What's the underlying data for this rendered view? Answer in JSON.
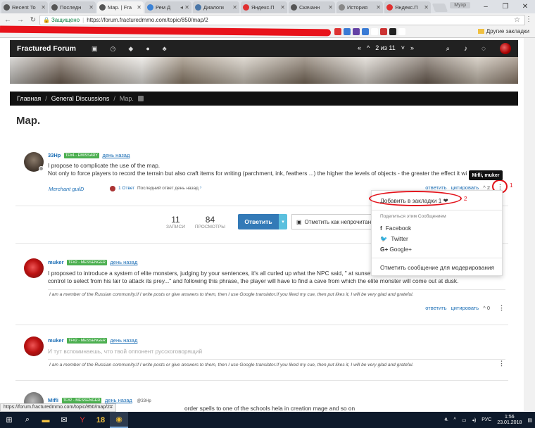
{
  "browser": {
    "tabs": [
      {
        "label": "Recent To",
        "color": "#555555"
      },
      {
        "label": "Последн",
        "color": "#555555"
      },
      {
        "label": "Map. | Fra",
        "color": "#555555",
        "active": true
      },
      {
        "label": "Рем Д",
        "color": "#3b82d6"
      },
      {
        "label": "Диалоги",
        "color": "#4a76a8"
      },
      {
        "label": "Яндекс.П",
        "color": "#e03030"
      },
      {
        "label": "Скачанн",
        "color": "#555555"
      },
      {
        "label": "История",
        "color": "#888888"
      },
      {
        "label": "Яндекс.П",
        "color": "#e03030"
      }
    ],
    "user_chip": "Мухр",
    "secure_label": "Защищено",
    "url": "https://forum.fracturedmmo.com/topic/850/map/2",
    "other_bookmarks": "Другие закладки",
    "status_url": "https://forum.fracturedmmo.com/topic/850/map/2#"
  },
  "forum": {
    "brand": "Fractured Forum",
    "pager": {
      "first": "«",
      "prev": "^",
      "page": "2 из 11",
      "next": "˅",
      "last": "»"
    },
    "nav_icons": [
      "inbox-icon",
      "clock-icon",
      "tags-icon",
      "user-icon",
      "group-icon"
    ],
    "breadcrumb": [
      "Главная",
      "General Discussions",
      "Map."
    ],
    "title": "Map."
  },
  "posts": [
    {
      "user": "33Hp",
      "badge": "TF#4 - EMISSARY",
      "when": "день назад",
      "lines": [
        "I propose to complicate the use of the map.",
        "Not only to force players to record the terrain but also craft items for writing (parchment, ink, feathers ...) the higher the levels of objects - the greater the effect it wi"
      ],
      "guild": "Merchant guilD",
      "replies": "1 Ответ",
      "last_reply": "Последний ответ день назад",
      "reply": "ответить",
      "quote": "цитировать",
      "votes": "2"
    },
    {
      "user": "muker",
      "badge": "TF#2 - MESSENGER",
      "when": "день назад",
      "lines": [
        "I proposed to introduce a system of elite monsters, judging by your sentences, it's all curled up what the NPC said, \" at sunset",
        "control to select from his lair to attack its prey...\" and following this phrase, the player will have to find a cave from which the elite monster will come out at dusk."
      ],
      "sig": "I am a member of the Russian community.If I write posts or give answers to them, then I use Google translator.If you liked my cue, then put likes it, I will be very glad and grateful.",
      "reply": "ответить",
      "quote": "цитировать",
      "votes": "0"
    },
    {
      "user": "muker",
      "badge": "TF#2 - MESSENGER",
      "when": "день назад",
      "line": "И тут вспоминаешь, что твой оппонент русскоговорящий",
      "sig": "I am a member of the Russian community.If I write posts or give answers to them, then I use Google translator.If you liked my cue, then put likes it, I will be very glad and grateful."
    },
    {
      "user": "Mifli",
      "badge": "TF#2 - MESSENGER",
      "when": "день назад",
      "extra": "@33Hp",
      "line": "order spells to one of the schools hela in creation mage and so on"
    }
  ],
  "stats": {
    "posts_n": "11",
    "posts_l": "ЗАПИСИ",
    "views_n": "84",
    "views_l": "ПРОСМОТРЫ",
    "reply_btn": "Ответить",
    "unread_btn": "Отметить как непрочитанн"
  },
  "dropdown": {
    "bookmark": "Добавить в закладки 1",
    "share_header": "Поделиться этим Сообщением",
    "facebook": "Facebook",
    "twitter": "Twitter",
    "google": "Google+",
    "flag": "Отметить сообщение для модерирования"
  },
  "tooltip": "Mifli, muker",
  "annotations": {
    "one": "1",
    "two": "2"
  },
  "taskbar": {
    "lang": "РУС",
    "time": "1:56",
    "date": "23.01.2018"
  }
}
